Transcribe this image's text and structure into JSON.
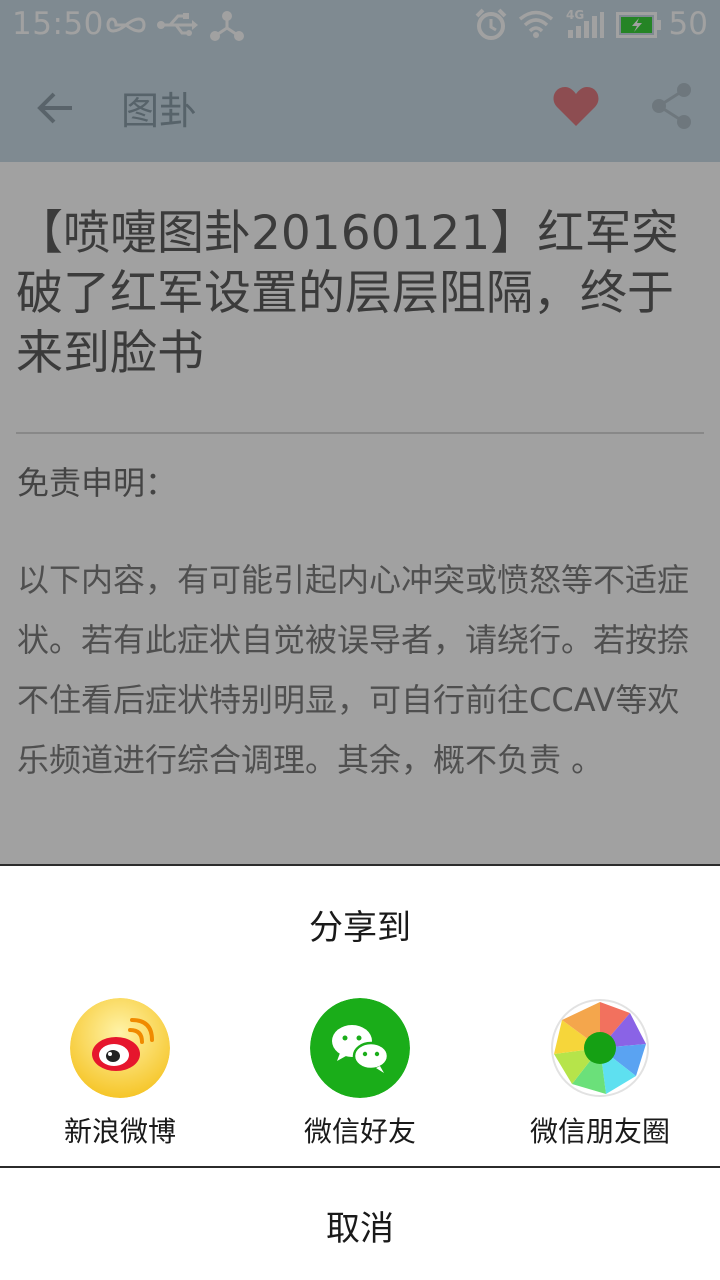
{
  "status_bar": {
    "time": "15:50",
    "battery": "50",
    "network": "4G",
    "icons": [
      "infinity-icon",
      "usb-icon",
      "share-network-icon",
      "alarm-icon",
      "wifi-icon",
      "signal-icon",
      "battery-icon"
    ]
  },
  "app_bar": {
    "title": "图卦",
    "icons": [
      "back-arrow-icon",
      "heart-icon",
      "share-icon"
    ],
    "heart_color": "#e07b80"
  },
  "article": {
    "title": "【喷嚏图卦20160121】红军突破了红军设置的层层阻隔，终于来到脸书",
    "disclaimer_heading": "免责申明：",
    "disclaimer_body": "以下内容，有可能引起内心冲突或愤怒等不适症状。若有此症状自觉被误导者，请绕行。若按捺不住看后症状特别明显，可自行前往CCAV等欢乐频道进行综合调理。其余，概不负责 。"
  },
  "share_sheet": {
    "title": "分享到",
    "items": [
      {
        "label": "新浪微博",
        "icon": "weibo-icon"
      },
      {
        "label": "微信好友",
        "icon": "wechat-icon"
      },
      {
        "label": "微信朋友圈",
        "icon": "wechat-moments-icon"
      }
    ],
    "cancel_label": "取消"
  },
  "colors": {
    "toolbar": "#c9dbe6",
    "wechat_green": "#1aad19",
    "weibo_yellow": "#f7cd2e"
  }
}
